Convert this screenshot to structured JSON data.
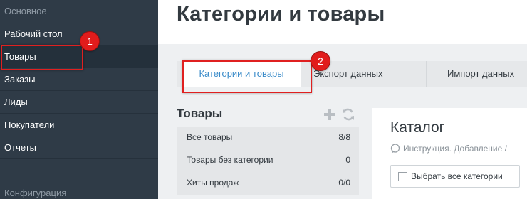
{
  "sidebar": {
    "section_main": "Основное",
    "items": [
      {
        "label": "Рабочий стол"
      },
      {
        "label": "Товары"
      },
      {
        "label": "Заказы"
      },
      {
        "label": "Лиды"
      },
      {
        "label": "Покупатели"
      },
      {
        "label": "Отчеты"
      }
    ],
    "active_item": "Товары",
    "section_config": "Конфигурация"
  },
  "header": {
    "title": "Категории и товары"
  },
  "tabs": [
    {
      "label": "Категории и товары",
      "active": true
    },
    {
      "label": "Экспорт данных",
      "active": false
    },
    {
      "label": "Импорт данных",
      "active": false
    }
  ],
  "products": {
    "title": "Товары",
    "add_icon": "plus-icon",
    "refresh_icon": "refresh-icon",
    "rows": [
      {
        "name": "Все товары",
        "count": "8/8"
      },
      {
        "name": "Товары без категории",
        "count": "0"
      },
      {
        "name": "Хиты продаж",
        "count": "0/0"
      }
    ]
  },
  "catalog": {
    "title": "Каталог",
    "instruction": "Инструкция. Добавление /",
    "select_all_label": "Выбрать все категории"
  },
  "annotations": [
    {
      "label": "1"
    },
    {
      "label": "2"
    }
  ],
  "colors": {
    "sidebar_bg": "#2f3b47",
    "accent": "#3a8bc9",
    "annotation_red": "#e11c1c"
  }
}
